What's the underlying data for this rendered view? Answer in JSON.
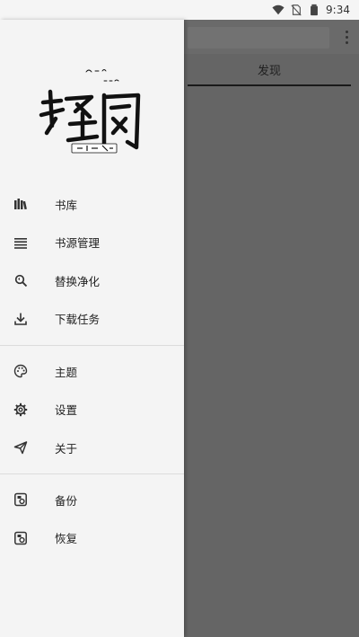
{
  "status_bar": {
    "time": "9:34"
  },
  "app": {
    "tab_label": "发现"
  },
  "drawer": {
    "group1": [
      {
        "label": "书库",
        "icon": "bookshelf-icon"
      },
      {
        "label": "书源管理",
        "icon": "list-icon"
      },
      {
        "label": "替换净化",
        "icon": "find-replace-icon"
      },
      {
        "label": "下载任务",
        "icon": "download-icon"
      }
    ],
    "group2": [
      {
        "label": "主题",
        "icon": "palette-icon"
      },
      {
        "label": "设置",
        "icon": "gear-icon"
      },
      {
        "label": "关于",
        "icon": "send-icon"
      }
    ],
    "group3": [
      {
        "label": "备份",
        "icon": "backup-icon"
      },
      {
        "label": "恢复",
        "icon": "restore-icon"
      }
    ]
  }
}
